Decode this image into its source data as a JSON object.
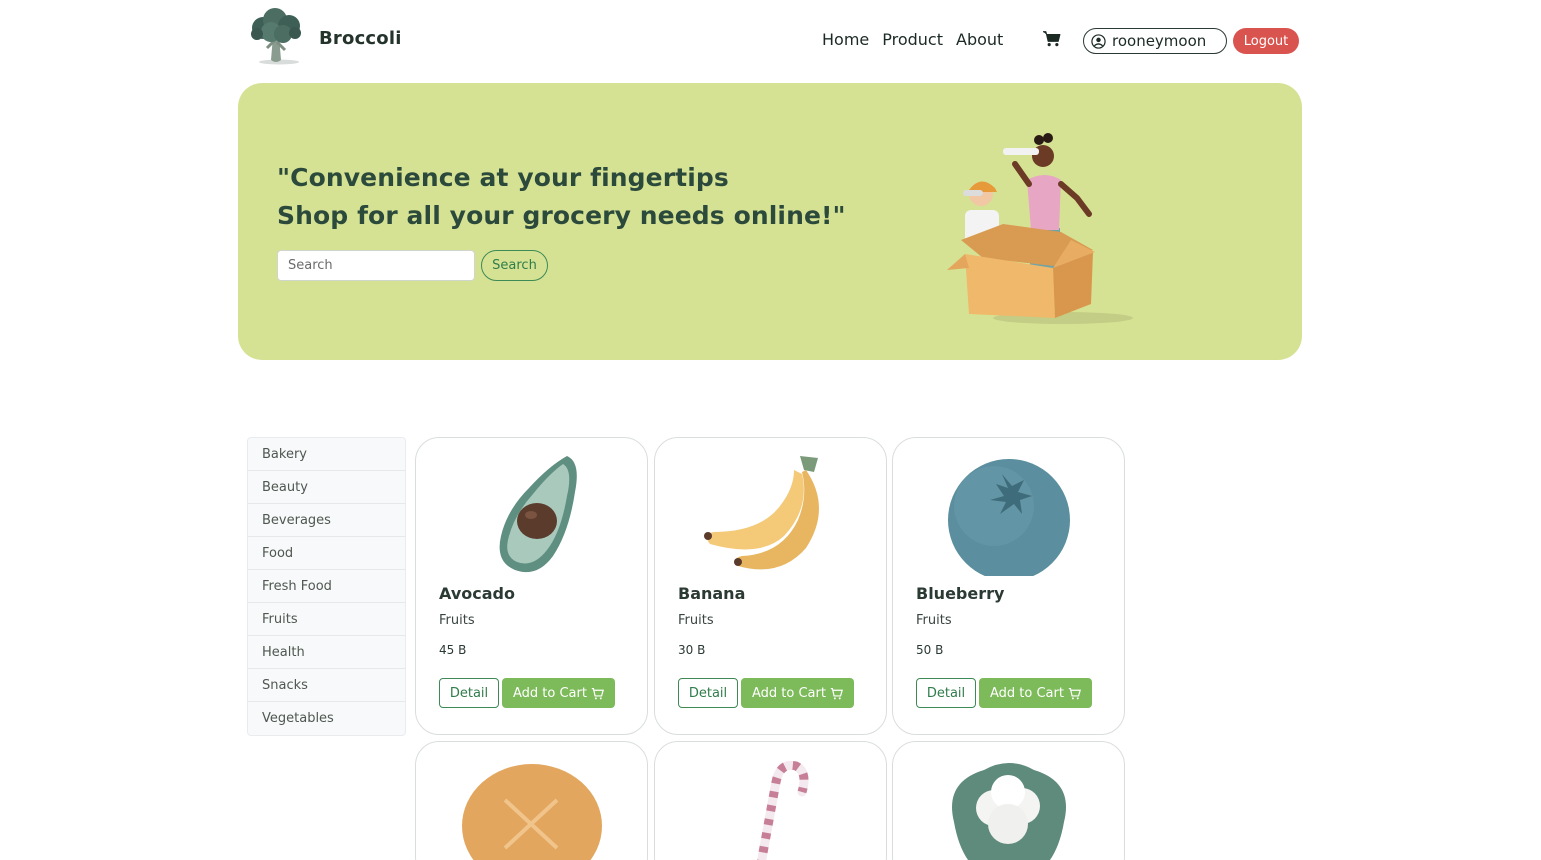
{
  "header": {
    "brand": "Broccoli",
    "nav": [
      "Home",
      "Product",
      "About"
    ],
    "username": "rooneymoon",
    "logout_label": "Logout"
  },
  "hero": {
    "line1": "\"Convenience at your fingertips",
    "line2": "Shop for all your grocery needs online!\"",
    "search_placeholder": "Search",
    "search_button": "Search"
  },
  "categories": [
    "Bakery",
    "Beauty",
    "Beverages",
    "Food",
    "Fresh Food",
    "Fruits",
    "Health",
    "Snacks",
    "Vegetables"
  ],
  "products": [
    {
      "name": "Avocado",
      "category": "Fruits",
      "price": "45 B",
      "detail_label": "Detail",
      "add_label": "Add to Cart",
      "icon": "avocado-icon"
    },
    {
      "name": "Banana",
      "category": "Fruits",
      "price": "30 B",
      "detail_label": "Detail",
      "add_label": "Add to Cart",
      "icon": "banana-icon"
    },
    {
      "name": "Blueberry",
      "category": "Fruits",
      "price": "50 B",
      "detail_label": "Detail",
      "add_label": "Add to Cart",
      "icon": "blueberry-icon"
    }
  ],
  "more_products_icons": [
    "bread-icon",
    "candy-cane-icon",
    "cauliflower-icon"
  ],
  "colors": {
    "hero_bg": "#d6e293",
    "accent_green": "#7cba5a",
    "outline_green": "#3d8a57",
    "logout_red": "#d9534f",
    "heading_dark": "#2c4a3c"
  }
}
